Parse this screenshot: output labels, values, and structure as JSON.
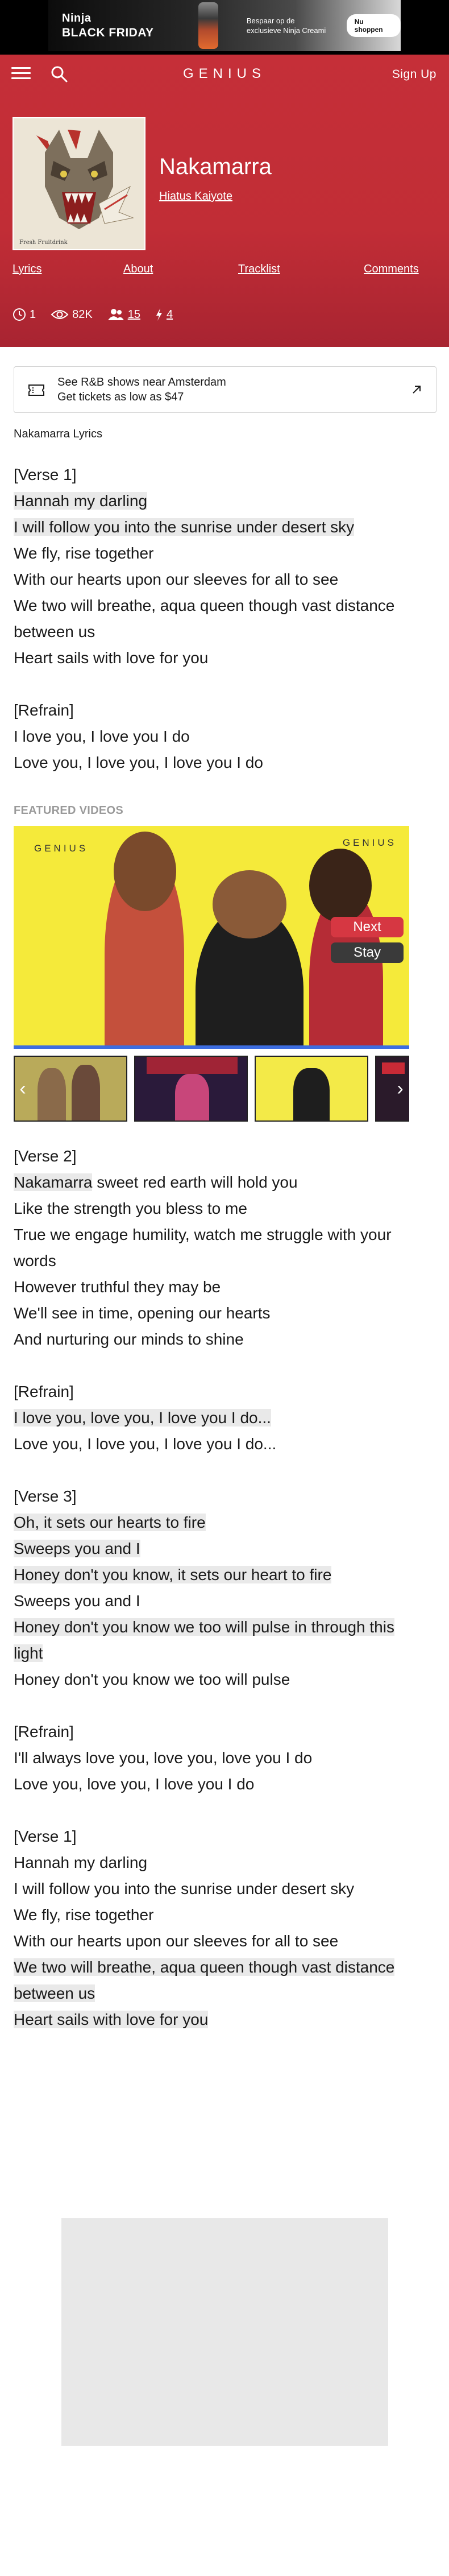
{
  "ad": {
    "brand_line1": "Ninja",
    "brand_line2": "BLACK FRIDAY",
    "copy": "Bespaar op de exclusieve Ninja Creami",
    "cta": "Nu shoppen"
  },
  "nav": {
    "logo": "GENIUS",
    "signup": "Sign Up"
  },
  "song": {
    "cover_label": "Fresh Fruitdrink",
    "title": "Nakamarra",
    "artist": "Hiatus Kaiyote",
    "tabs": [
      "Lyrics",
      "About",
      "Tracklist",
      "Comments"
    ],
    "stats": {
      "pageviews_rank": "1",
      "views": "82K",
      "contributors": "15",
      "edits": "4"
    }
  },
  "promo": {
    "line1": "See R&B shows near Amsterdam",
    "line2": "Get tickets as low as $47"
  },
  "lyrics": {
    "heading": "Nakamarra Lyrics",
    "block1": [
      {
        "t": "[Verse 1]",
        "h": false
      },
      {
        "t": "Hannah my darling",
        "h": true
      },
      {
        "t": "I will follow you into the sunrise under desert sky",
        "h": true
      },
      {
        "t": "We fly, rise together",
        "h": false
      },
      {
        "t": "With our hearts upon our sleeves for all to see",
        "h": false
      },
      {
        "t": "We two will breathe, aqua queen though vast distance between us",
        "h": false
      },
      {
        "t": "Heart sails with love for you",
        "h": false
      },
      {
        "t": "",
        "h": false
      },
      {
        "t": "[Refrain]",
        "h": false
      },
      {
        "t": "I love you, I love you I do",
        "h": false
      },
      {
        "t": "Love you, I love you, I love you I do",
        "h": false
      }
    ],
    "block2": [
      {
        "t": "[Verse 2]",
        "h": false
      },
      {
        "t": "Nakamarra sweet red earth will hold you",
        "h": true,
        "partial": "Nakamarra"
      },
      {
        "t": "Like the strength you bless to me",
        "h": false
      },
      {
        "t": "True we engage humility, watch me struggle with your words",
        "h": false
      },
      {
        "t": "However truthful they may be",
        "h": false
      },
      {
        "t": "We'll see in time, opening our hearts",
        "h": false
      },
      {
        "t": "And nurturing our minds to shine",
        "h": false
      },
      {
        "t": "",
        "h": false
      },
      {
        "t": "[Refrain]",
        "h": false
      },
      {
        "t": "I love you, love you, I love you I do...",
        "h": true
      },
      {
        "t": "Love you, I love you, I love you I do...",
        "h": false
      },
      {
        "t": "",
        "h": false
      },
      {
        "t": "[Verse 3]",
        "h": false
      },
      {
        "t": "Oh, it sets our hearts to fire",
        "h": true
      },
      {
        "t": "Sweeps you and I",
        "h": true
      },
      {
        "t": "Honey don't you know, it sets our heart to fire",
        "h": true
      },
      {
        "t": "Sweeps you and I",
        "h": false
      },
      {
        "t": "Honey don't you know we too will pulse in through this light",
        "h": true
      },
      {
        "t": "Honey don't you know we too will pulse",
        "h": false
      },
      {
        "t": "",
        "h": false
      },
      {
        "t": "[Refrain]",
        "h": false
      },
      {
        "t": "I'll always love you, love you, love you I do",
        "h": false
      },
      {
        "t": "Love you, love you, I love you I do",
        "h": false
      },
      {
        "t": "",
        "h": false
      },
      {
        "t": "[Verse 1]",
        "h": false
      },
      {
        "t": "Hannah my darling",
        "h": false
      },
      {
        "t": "I will follow you into the sunrise under desert sky",
        "h": false
      },
      {
        "t": "We fly, rise together",
        "h": false
      },
      {
        "t": "With our hearts upon our sleeves for all to see",
        "h": false
      },
      {
        "t": "We two will breathe, aqua queen though vast distance between us",
        "h": true
      },
      {
        "t": "Heart sails with love for you",
        "h": true
      }
    ]
  },
  "videos": {
    "label": "FEATURED VIDEOS",
    "logo": "GENIUS",
    "next": "Next",
    "stay": "Stay",
    "progress": 1.0
  },
  "colors": {
    "header_red": "#c52f38",
    "highlight": "#e9e9e9",
    "video_yellow": "#f5ea3a"
  }
}
